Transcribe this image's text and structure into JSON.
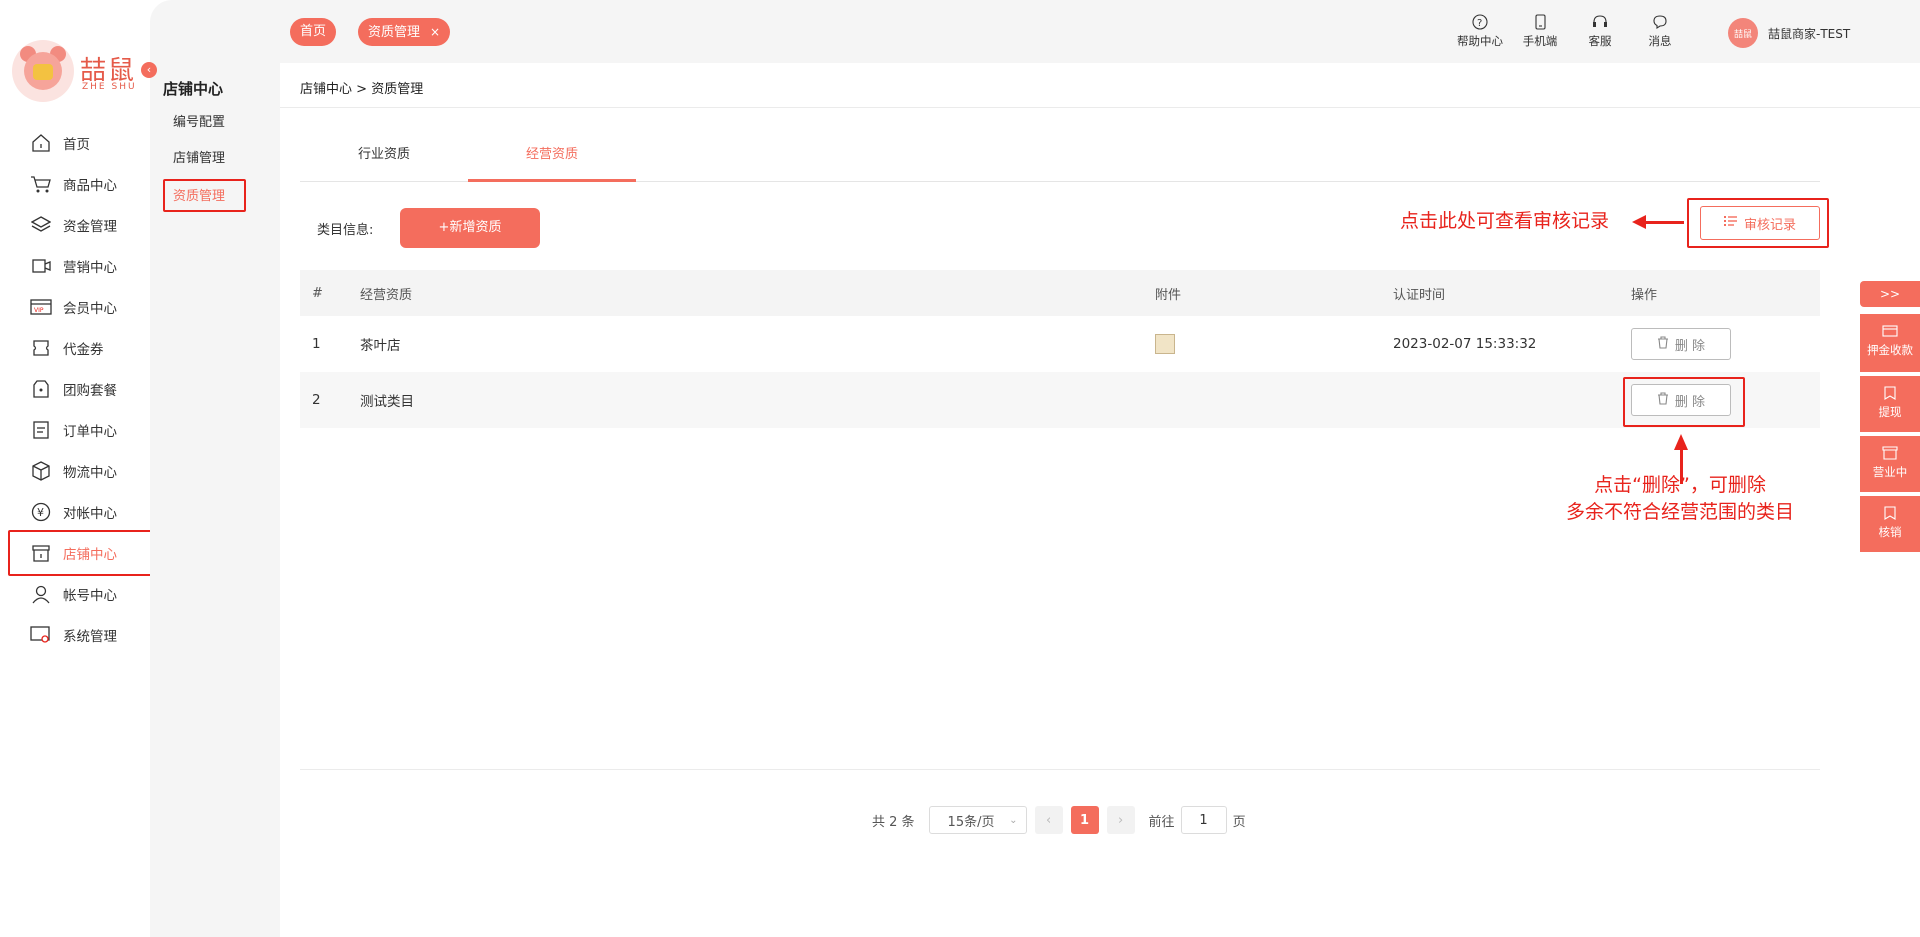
{
  "brand": {
    "name_cn": "喆鼠",
    "name_en": "ZHE SHU"
  },
  "sidebar": {
    "items": [
      {
        "label": "首页",
        "icon": "home-icon"
      },
      {
        "label": "商品中心",
        "icon": "cart-icon"
      },
      {
        "label": "资金管理",
        "icon": "layers-icon"
      },
      {
        "label": "营销中心",
        "icon": "marketing-icon"
      },
      {
        "label": "会员中心",
        "icon": "vip-card-icon"
      },
      {
        "label": "代金券",
        "icon": "voucher-icon"
      },
      {
        "label": "团购套餐",
        "icon": "tag-icon"
      },
      {
        "label": "订单中心",
        "icon": "order-list-icon"
      },
      {
        "label": "物流中心",
        "icon": "box-icon"
      },
      {
        "label": "对帐中心",
        "icon": "yuan-coin-icon"
      },
      {
        "label": "店铺中心",
        "icon": "store-icon"
      },
      {
        "label": "帐号中心",
        "icon": "user-icon"
      },
      {
        "label": "系统管理",
        "icon": "settings-screen-icon"
      }
    ],
    "active": "店铺中心"
  },
  "subnav": {
    "title": "店铺中心",
    "items": [
      {
        "label": "编号配置"
      },
      {
        "label": "店铺管理"
      },
      {
        "label": "资质管理"
      }
    ],
    "active": "资质管理"
  },
  "topbar": {
    "tags": [
      {
        "label": "首页"
      },
      {
        "label": "资质管理",
        "close": "×"
      }
    ],
    "actions": [
      {
        "label": "帮助中心",
        "icon": "help-circle-icon"
      },
      {
        "label": "手机端",
        "icon": "mobile-icon"
      },
      {
        "label": "客服",
        "icon": "headset-icon"
      },
      {
        "label": "消息",
        "icon": "chat-bubble-icon"
      }
    ],
    "user": {
      "avatar_text": "喆鼠",
      "name": "喆鼠商家-TEST"
    }
  },
  "breadcrumb": {
    "parent": "店铺中心",
    "separator": ">",
    "current": "资质管理"
  },
  "tabs": [
    {
      "label": "行业资质"
    },
    {
      "label": "经营资质"
    }
  ],
  "active_tab": "经营资质",
  "toolbar": {
    "category_label": "类目信息:",
    "add_button": "+新增资质",
    "audit_button": "审核记录"
  },
  "annotations": {
    "audit_hint": "点击此处可查看审核记录",
    "delete_hint_line1": "点击“删除”，可删除",
    "delete_hint_line2": "多余不符合经营范围的类目"
  },
  "table": {
    "headers": {
      "index": "#",
      "name": "经营资质",
      "attachment": "附件",
      "time": "认证时间",
      "action": "操作"
    },
    "rows": [
      {
        "index": "1",
        "name": "茶叶店",
        "has_attachment": true,
        "time": "2023-02-07 15:33:32",
        "action": "删 除"
      },
      {
        "index": "2",
        "name": "测试类目",
        "has_attachment": false,
        "time": "",
        "action": "删 除"
      }
    ]
  },
  "pagination": {
    "total": "共 2 条",
    "page_size": "15条/页",
    "current_page": "1",
    "goto_label": "前往",
    "goto_value": "1",
    "page_unit": "页"
  },
  "right_panel": {
    "toggle": ">>",
    "items": [
      {
        "label": "押金收款",
        "icon": "deposit-icon"
      },
      {
        "label": "提现",
        "icon": "withdraw-icon"
      },
      {
        "label": "营业中",
        "icon": "shop-open-icon"
      },
      {
        "label": "核销",
        "icon": "verify-icon"
      }
    ]
  },
  "colors": {
    "accent": "#f46d5d",
    "annotation_red": "#e8231c",
    "sidebar_bg": "#f5f5f5"
  }
}
